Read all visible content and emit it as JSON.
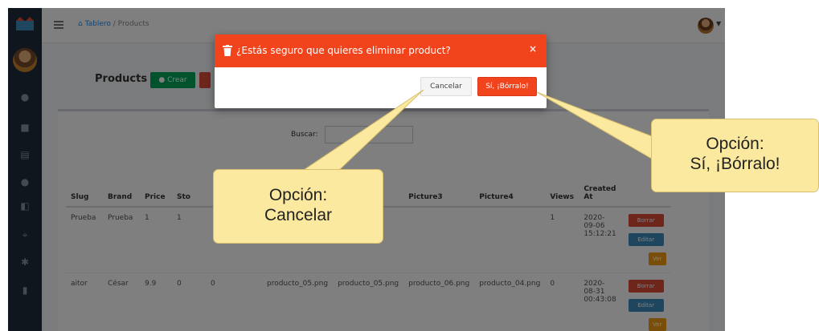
{
  "breadcrumb": {
    "home": "Tablero",
    "separator": "/",
    "current": "Products"
  },
  "page": {
    "title": "Products",
    "create_label": "Crear"
  },
  "search": {
    "label": "Buscar:"
  },
  "table": {
    "columns": [
      "Slug",
      "Brand",
      "Price",
      "Sto",
      "",
      "",
      "e2",
      "Picture3",
      "Picture4",
      "Views",
      "Created At",
      ""
    ],
    "rows": [
      {
        "cells": [
          "Prueba",
          "Prueba",
          "1",
          "1",
          "",
          "",
          "",
          "",
          "",
          "1",
          "2020-09-06 15:12:21"
        ]
      },
      {
        "cells": [
          "aitor",
          "César",
          "9.9",
          "0",
          "0",
          "producto_05.png",
          "producto_05.png",
          "producto_06.png",
          "producto_04.png",
          "0",
          "2020-08-31 00:43:08"
        ]
      }
    ],
    "action_labels": {
      "delete": "Borrar",
      "edit": "Editar",
      "view": "Ver"
    }
  },
  "modal": {
    "title": "¿Estás seguro que quieres eliminar product?",
    "close_glyph": "×",
    "cancel_label": "Cancelar",
    "confirm_label": "Sí, ¡Bórralo!"
  },
  "callouts": {
    "cancel": {
      "line1": "Opción:",
      "line2": "Cancelar"
    },
    "confirm": {
      "line1": "Opción:",
      "line2": "Sí, ¡Bórralo!"
    }
  },
  "icons": {
    "trash": "trash-icon",
    "close": "close-icon",
    "menu": "hamburger-icon",
    "home": "home-icon",
    "caret": "caret-down-icon"
  },
  "colors": {
    "modal_header": "#f1431c",
    "confirm_button": "#f1431c",
    "callout_fill": "#fbe9a0",
    "sidebar": "#1f2d3d",
    "create_button": "#00a65a"
  }
}
